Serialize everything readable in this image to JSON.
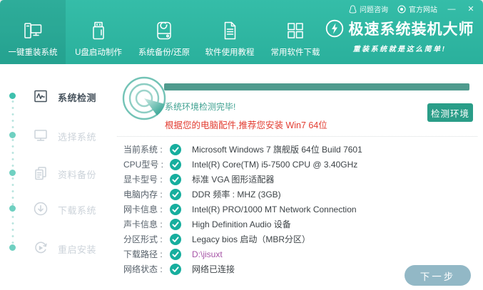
{
  "topbar": {
    "support_label": "问题咨询",
    "website_label": "官方网站",
    "minimize_label": "—",
    "close_label": "✕"
  },
  "header": {
    "tabs": [
      {
        "label": "一键重装系统",
        "icon": "computer-icon",
        "active": true
      },
      {
        "label": "U盘启动制作",
        "icon": "usb-drive-icon",
        "active": false
      },
      {
        "label": "系统备份/还原",
        "icon": "drive-backup-icon",
        "active": false
      },
      {
        "label": "软件使用教程",
        "icon": "document-icon",
        "active": false
      },
      {
        "label": "常用软件下载",
        "icon": "grid-icon",
        "active": false
      }
    ],
    "logo": {
      "title": "极速系统装机大师",
      "tagline": "重装系统就是这么简单!"
    }
  },
  "sidebar": {
    "steps": [
      {
        "label": "系统检测",
        "icon": "system-check-icon",
        "active": true
      },
      {
        "label": "选择系统",
        "icon": "select-system-icon",
        "active": false
      },
      {
        "label": "资料备份",
        "icon": "data-backup-icon",
        "active": false
      },
      {
        "label": "下载系统",
        "icon": "download-icon",
        "active": false
      },
      {
        "label": "重启安装",
        "icon": "restart-icon",
        "active": false
      }
    ]
  },
  "main": {
    "progress_percent": 100,
    "status_text": "系统环境检测完毕!",
    "recommend_text": "根据您的电脑配件,推荐您安装 Win7 64位",
    "detect_button_label": "检测环境",
    "next_button_label": "下一步",
    "info_rows": [
      {
        "label": "当前系统 :",
        "value": "Microsoft Windows 7 旗舰版  64位 Build 7601"
      },
      {
        "label": "CPU型号 :",
        "value": "Intel(R) Core(TM) i5-7500 CPU @ 3.40GHz"
      },
      {
        "label": "显卡型号 :",
        "value": "标准 VGA 图形适配器"
      },
      {
        "label": "电脑内存 :",
        "value": "DDR 频率 : MHZ (3GB)"
      },
      {
        "label": "网卡信息 :",
        "value": "Intel(R) PRO/1000 MT Network Connection"
      },
      {
        "label": "声卡信息 :",
        "value": "High Definition Audio 设备"
      },
      {
        "label": "分区形式 :",
        "value": "Legacy bios 启动（MBR分区）"
      },
      {
        "label": "下载路径 :",
        "value": "D:\\jisuxt"
      },
      {
        "label": "网络状态 :",
        "value": "网络已连接"
      }
    ]
  },
  "colors": {
    "header_teal": "#2db5a1",
    "accent_teal": "#17ae9e",
    "progress_teal": "#4f9b8e",
    "status_teal": "#3fa191",
    "alert_red": "#e23c30",
    "path_purple": "#a653a6",
    "next_button_blue": "#92b8c6"
  }
}
